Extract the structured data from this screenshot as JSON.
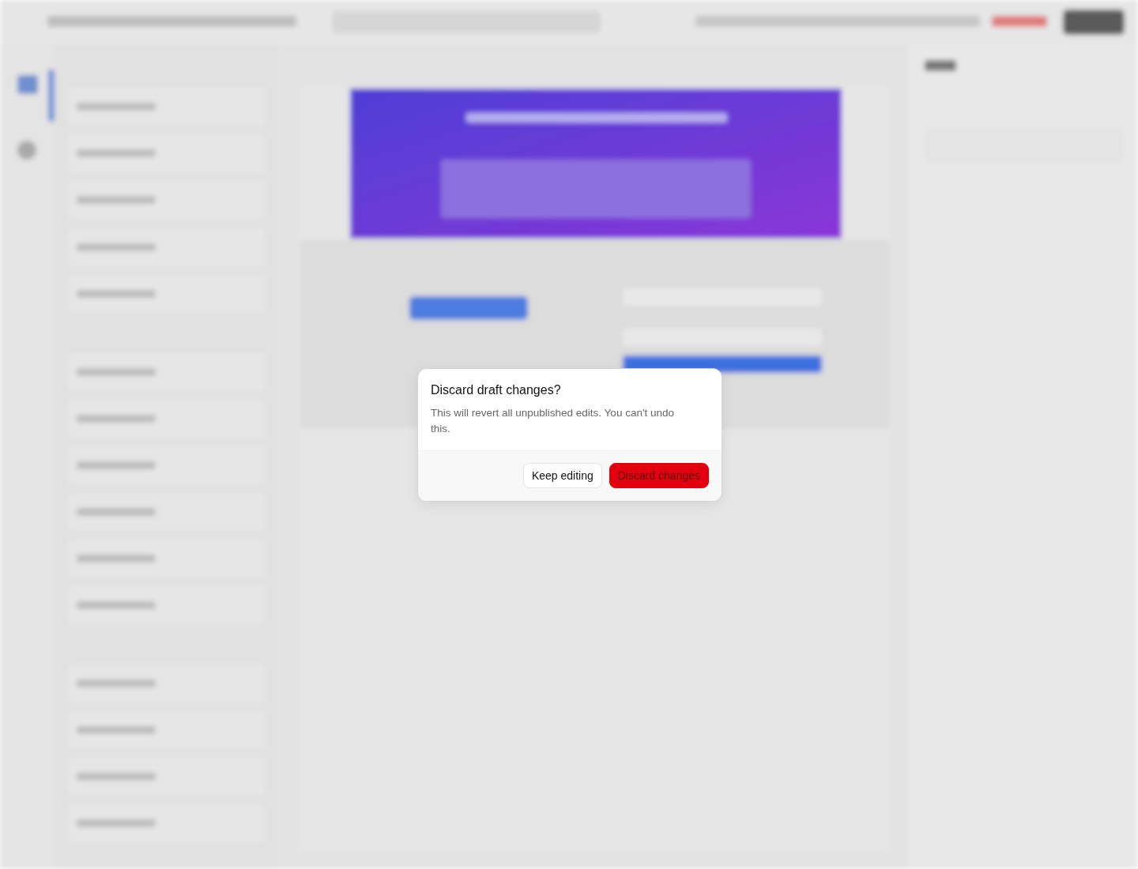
{
  "dialog": {
    "title": "Discard draft changes?",
    "message": "This will revert all unpublished edits. You can't undo this.",
    "buttons": [
      {
        "label": "Keep editing",
        "kind": "secondary"
      },
      {
        "label": "Discard changes",
        "kind": "danger"
      }
    ]
  }
}
